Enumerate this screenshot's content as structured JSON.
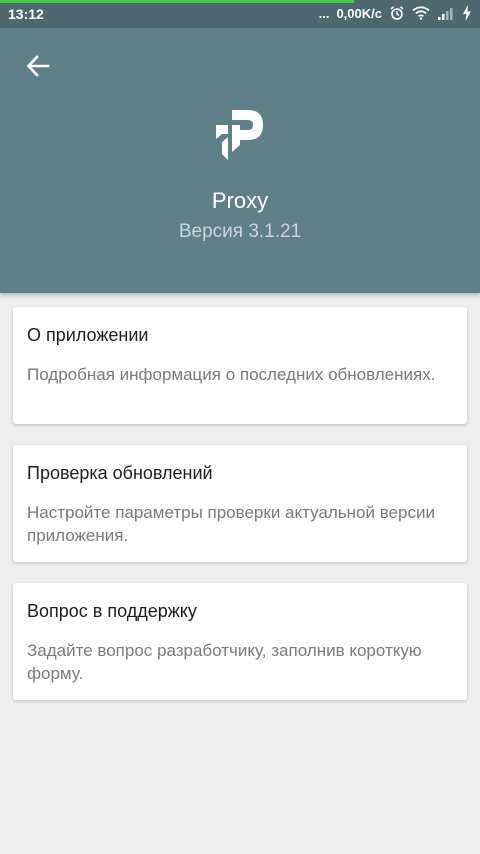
{
  "status_bar": {
    "time": "13:12",
    "dots": "...",
    "network_speed": "0,00K/c",
    "icons": [
      "alarm-icon",
      "wifi-icon",
      "signal-icon",
      "charging-icon"
    ],
    "progress_color": "#3cd03c"
  },
  "header": {
    "back_icon": "arrow-back-icon",
    "logo_icon": "proxy-logo-icon",
    "app_name": "Proxy",
    "version": "Версия 3.1.21",
    "background_color": "#5f7f89"
  },
  "cards": [
    {
      "title": "О приложении",
      "description": "Подробная информация о последних обновлениях."
    },
    {
      "title": "Проверка обновлений",
      "description": "Настройте параметры проверки актуальной версии приложения."
    },
    {
      "title": "Вопрос в поддержку",
      "description": "Задайте вопрос разработчику, заполнив короткую форму."
    }
  ]
}
